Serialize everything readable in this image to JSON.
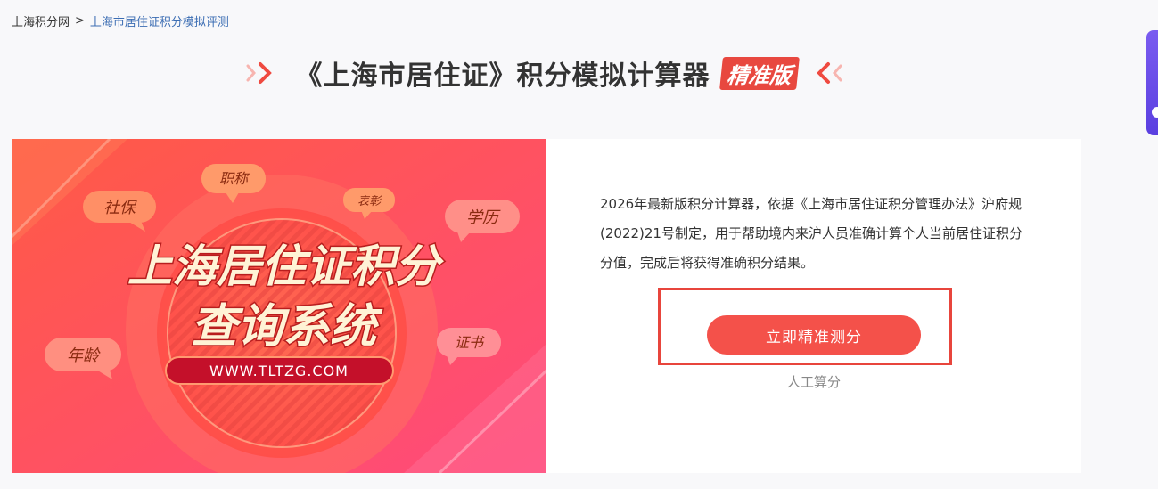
{
  "breadcrumb": {
    "home": "上海积分网",
    "separator": ">",
    "current": "上海市居住证积分模拟评测"
  },
  "title": {
    "text": "《上海市居住证》积分模拟计算器",
    "badge": "精准版"
  },
  "banner": {
    "headline_1": "上海居住证积分",
    "headline_2": "查询系统",
    "url": "WWW.TLTZG.COM",
    "bubbles": {
      "shebao": "社保",
      "zhicheng": "职称",
      "biaozhang": "表彰",
      "xueli": "学历",
      "nianling": "年龄",
      "zhengshu": "证书"
    }
  },
  "intro": {
    "text": "2026年最新版积分计算器，依据《上海市居住证积分管理办法》沪府规(2022)21号制定，用于帮助境内来沪人员准确计算个人当前居住证积分分值，完成后将获得准确积分结果。"
  },
  "actions": {
    "primary_label": "立即精准测分",
    "secondary_label": "人工算分"
  },
  "colors": {
    "accent": "#f4514a",
    "highlight_frame": "#e8453c",
    "breadcrumb_link": "#3b6db3"
  }
}
